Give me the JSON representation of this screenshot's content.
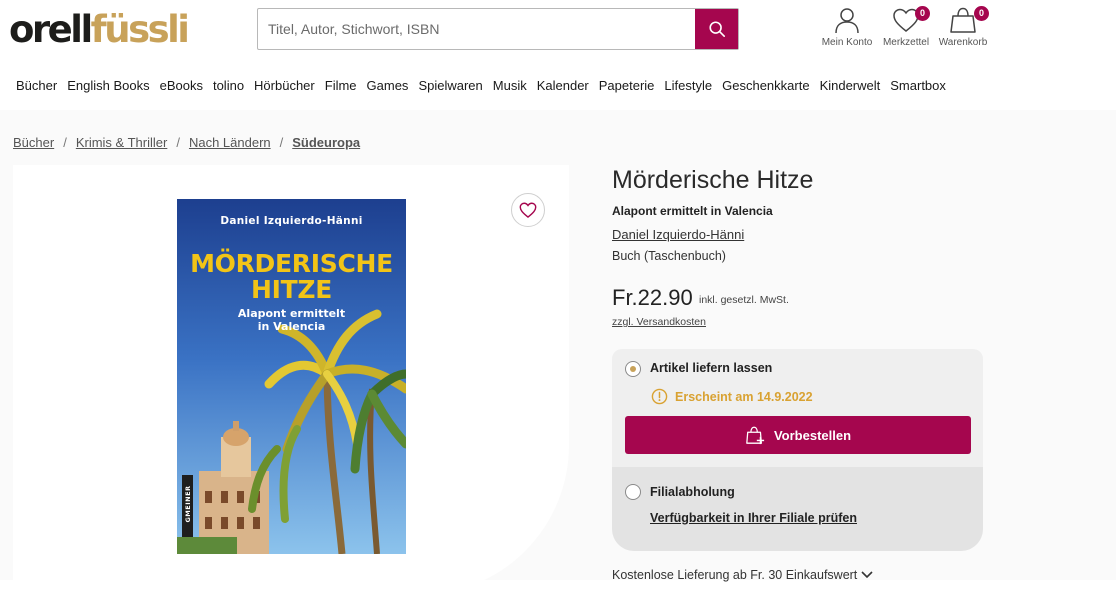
{
  "logo": {
    "part1": "orell",
    "part2": "füssli"
  },
  "search": {
    "placeholder": "Titel, Autor, Stichwort, ISBN"
  },
  "header": {
    "account_label": "Mein Konto",
    "wishlist_label": "Merkzettel",
    "wishlist_count": "0",
    "cart_label": "Warenkorb",
    "cart_count": "0"
  },
  "nav": [
    "Bücher",
    "English Books",
    "eBooks",
    "tolino",
    "Hörbücher",
    "Filme",
    "Games",
    "Spielwaren",
    "Musik",
    "Kalender",
    "Papeterie",
    "Lifestyle",
    "Geschenkkarte",
    "Kinderwelt",
    "Smartbox"
  ],
  "breadcrumb": {
    "items": [
      "Bücher",
      "Krimis & Thriller",
      "Nach Ländern"
    ],
    "current": "Südeuropa",
    "separator": "/"
  },
  "cover": {
    "author": "Daniel Izquierdo-Hänni",
    "title": "MÖRDERISCHE\nHITZE",
    "subtitle": "Alapont ermittelt\nin Valencia",
    "publisher": "GMEINER"
  },
  "product": {
    "title": "Mörderische Hitze",
    "subtitle": "Alapont ermittelt in Valencia",
    "author": "Daniel Izquierdo-Hänni",
    "format": "Buch (Taschenbuch)",
    "price": "Fr.22.90",
    "vat_note": "inkl. gesetzl. MwSt.",
    "shipping_link": "zzgl. Versandkosten"
  },
  "delivery": {
    "option_label": "Artikel liefern lassen",
    "selected": true,
    "notice": "Erscheint am 14.9.2022",
    "button_label": "Vorbestellen"
  },
  "pickup": {
    "option_label": "Filialabholung",
    "selected": false,
    "link": "Verfügbarkeit in Ihrer Filiale prüfen"
  },
  "free_shipping": "Kostenlose Lieferung ab Fr. 30 Einkaufswert",
  "colors": {
    "brand": "#a5064e",
    "gold": "#c8a25a",
    "notice": "#d9a232"
  },
  "icons": [
    "search-icon",
    "user-icon",
    "heart-icon",
    "bag-icon",
    "alert-circle-icon",
    "cart-plus-icon",
    "chevron-down-icon"
  ]
}
